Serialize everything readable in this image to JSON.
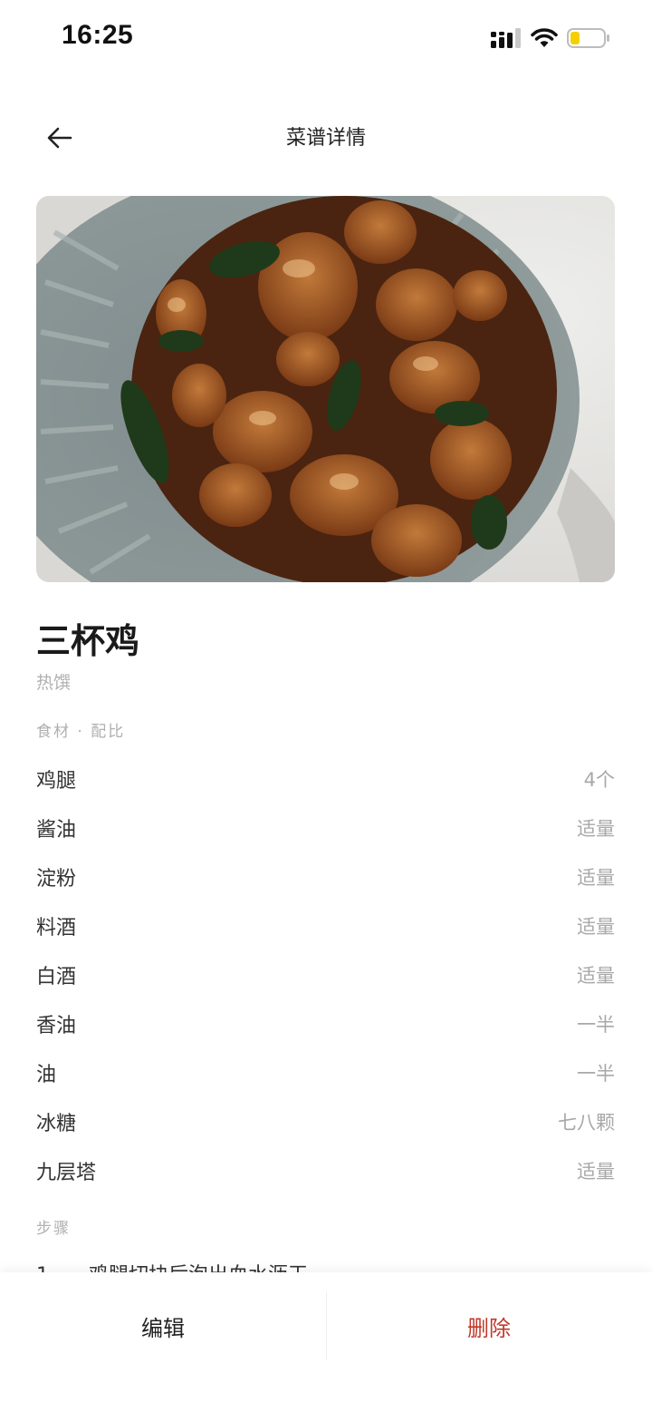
{
  "status_bar": {
    "time": "16:25",
    "battery_color": "#f5d000"
  },
  "nav": {
    "title": "菜谱详情"
  },
  "recipe": {
    "name": "三杯鸡",
    "category": "热馔"
  },
  "ingredients_section": {
    "label": "食材 · 配比"
  },
  "ingredients": [
    {
      "name": "鸡腿",
      "amount": "4个"
    },
    {
      "name": "酱油",
      "amount": "适量"
    },
    {
      "name": "淀粉",
      "amount": "适量"
    },
    {
      "name": "料酒",
      "amount": "适量"
    },
    {
      "name": "白酒",
      "amount": "适量"
    },
    {
      "name": "香油",
      "amount": "一半"
    },
    {
      "name": "油",
      "amount": "一半"
    },
    {
      "name": "冰糖",
      "amount": "七八颗"
    },
    {
      "name": "九层塔",
      "amount": "适量"
    }
  ],
  "steps_section": {
    "label": "步骤"
  },
  "steps": [
    {
      "number": "1",
      "text": "鸡腿切块后泡出血水沥干"
    }
  ],
  "bottom_bar": {
    "edit_label": "编辑",
    "delete_label": "删除",
    "delete_color": "#c0392b"
  }
}
